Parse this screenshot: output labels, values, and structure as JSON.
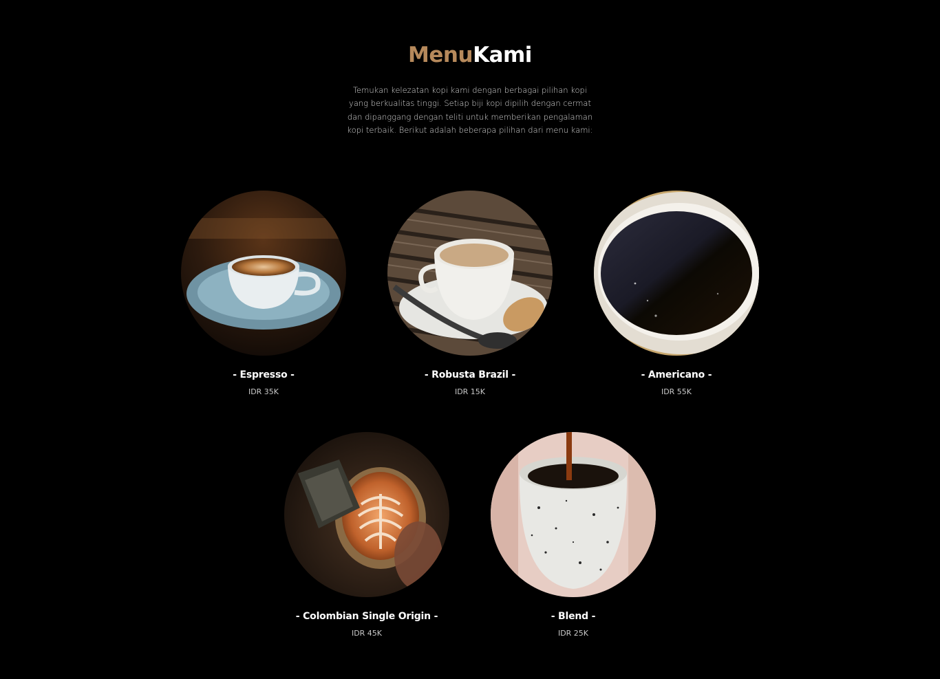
{
  "section": {
    "title_accent": "Menu",
    "title_plain": "Kami",
    "accent_color": "#b6895b",
    "description": "Temukan kelezatan kopi kami dengan berbagai pilihan kopi yang berkualitas tinggi. Setiap biji kopi dipilih dengan cermat dan dipanggang dengan teliti untuk memberikan pengalaman kopi terbaik. Berikut adalah beberapa pilihan dari menu kami:"
  },
  "menu": [
    {
      "name": "- Espresso -",
      "price": "IDR 35K",
      "image": "espresso-cup-photo"
    },
    {
      "name": "- Robusta Brazil -",
      "price": "IDR 15K",
      "image": "coffee-cup-on-table-photo"
    },
    {
      "name": "- Americano -",
      "price": "IDR 55K",
      "image": "black-coffee-closeup-photo"
    },
    {
      "name": "- Colombian Single Origin -",
      "price": "IDR 45K",
      "image": "latte-art-pour-photo"
    },
    {
      "name": "- Blend -",
      "price": "IDR 25K",
      "image": "pour-into-speckled-cup-photo"
    }
  ]
}
